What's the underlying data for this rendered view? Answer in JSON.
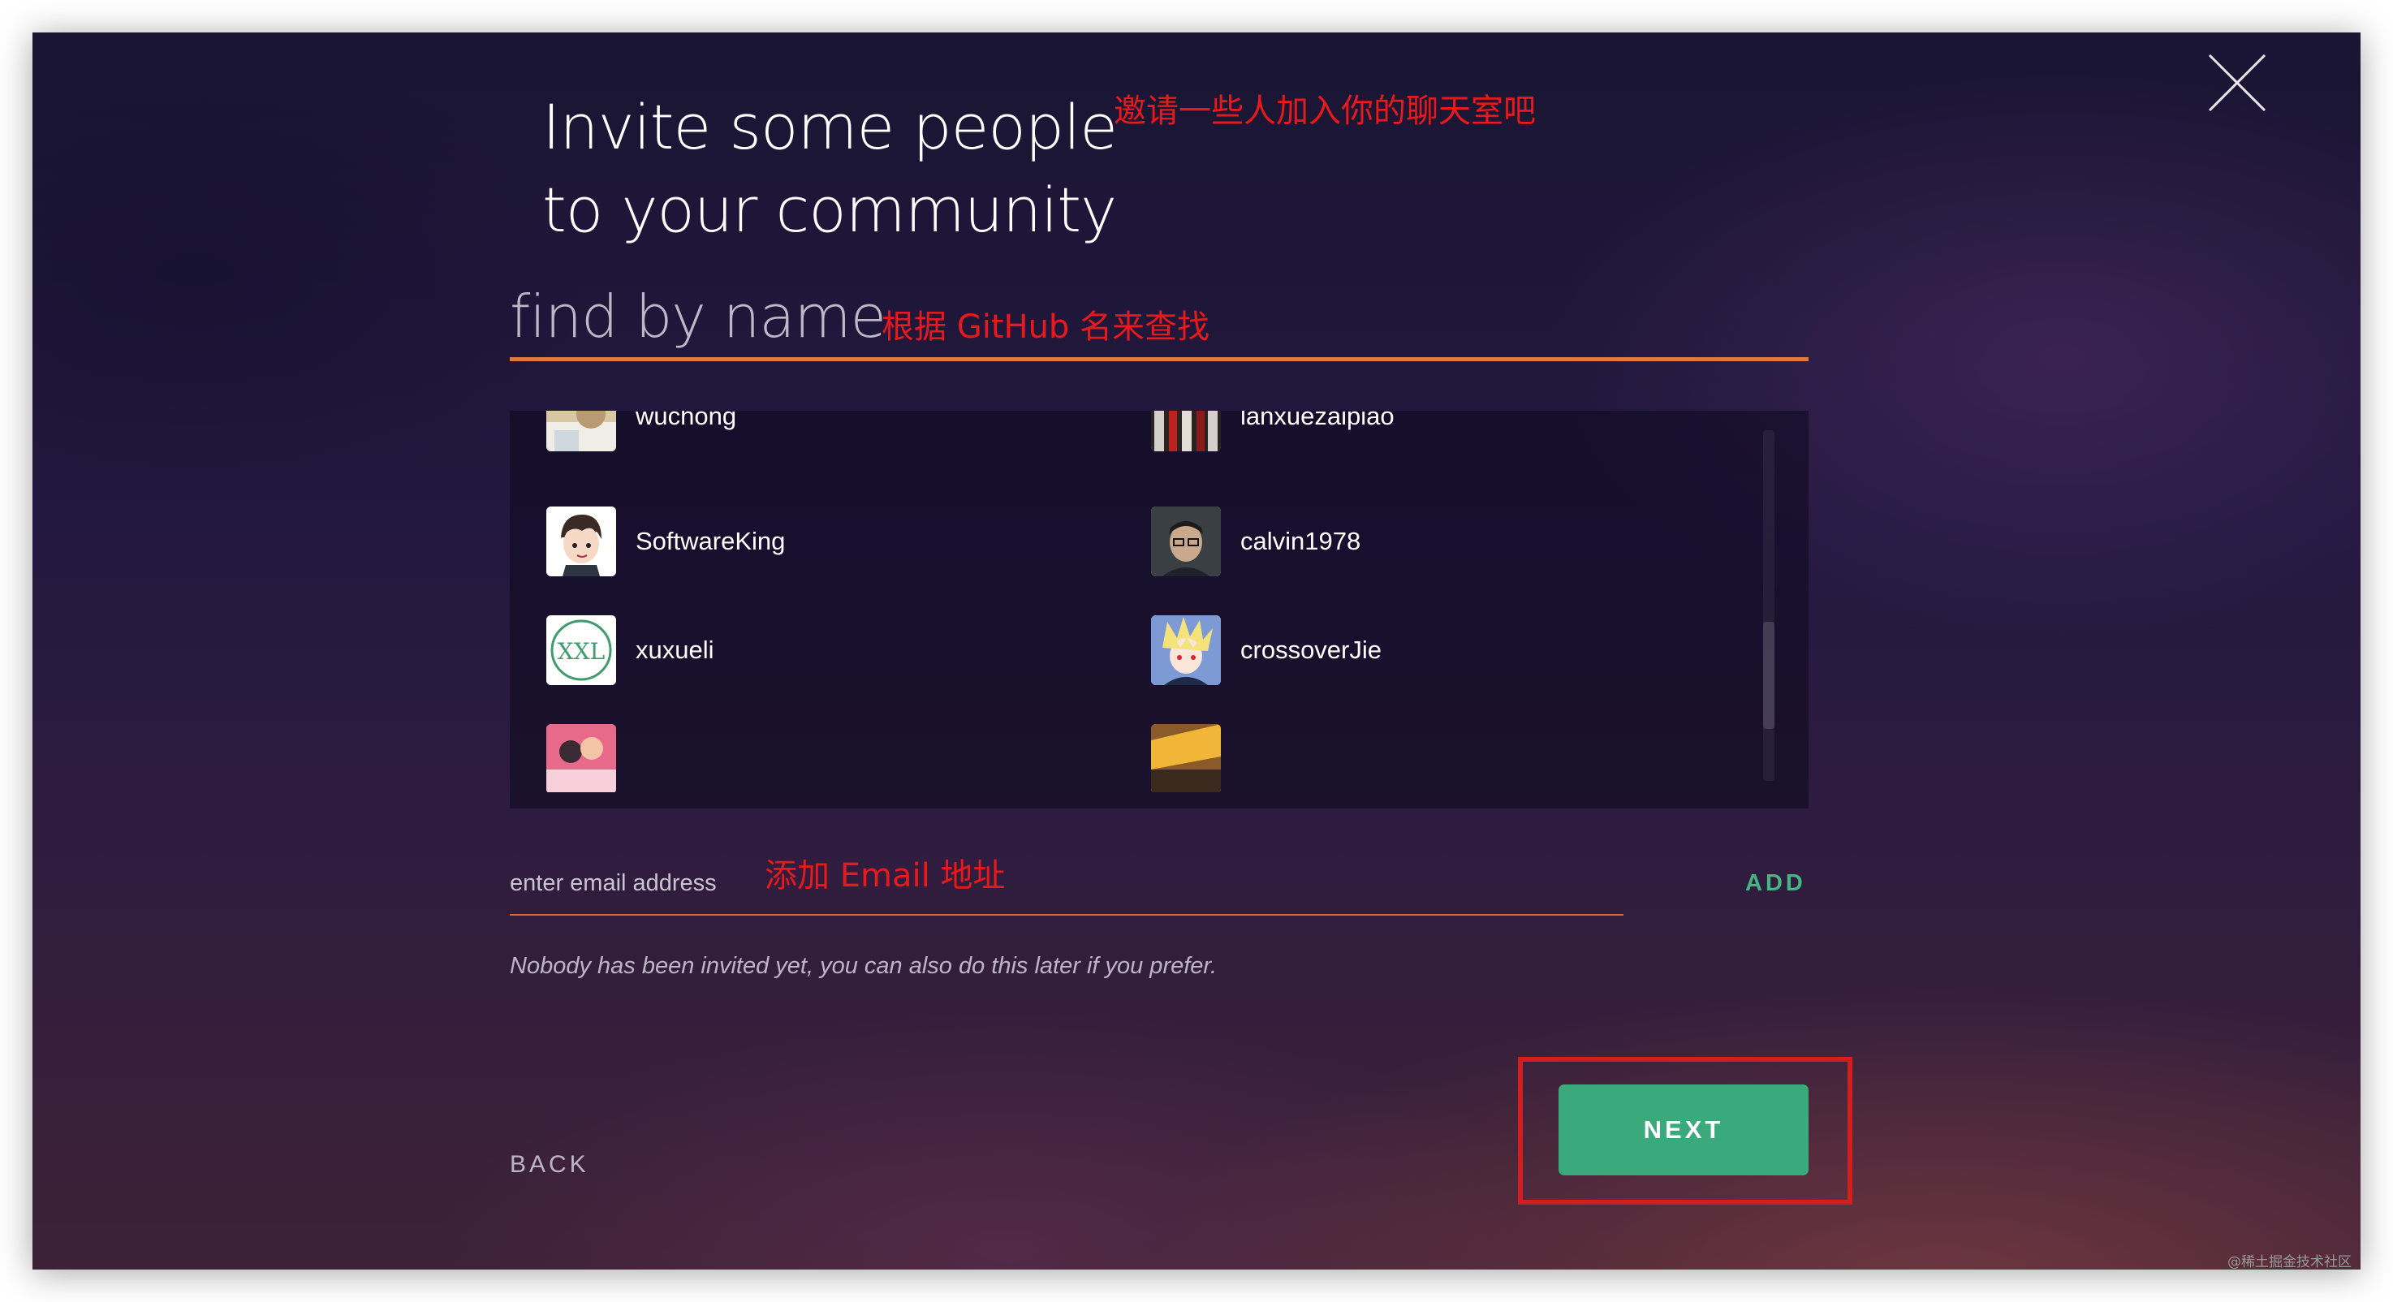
{
  "dialog": {
    "title_line1": "Invite some people",
    "title_line2": "to your community",
    "title_note": "邀请一些人加入你的聊天室吧"
  },
  "search": {
    "placeholder": "find by name",
    "note": "根据 GitHub 名来查找"
  },
  "people": [
    {
      "name": "wuchong",
      "column": "left",
      "avatar": "photo-avatar"
    },
    {
      "name": "lanxuezaipiao",
      "column": "right",
      "avatar": "photo-avatar"
    },
    {
      "name": "SoftwareKing",
      "column": "left",
      "avatar": "cartoon-boy-avatar"
    },
    {
      "name": "calvin1978",
      "column": "right",
      "avatar": "photo-avatar"
    },
    {
      "name": "xuxueli",
      "column": "left",
      "avatar": "xxl-logo-avatar"
    },
    {
      "name": "crossoverJie",
      "column": "right",
      "avatar": "anime-avatar"
    },
    {
      "name": "",
      "column": "left",
      "avatar": "photo-avatar"
    },
    {
      "name": "",
      "column": "right",
      "avatar": "photo-avatar"
    }
  ],
  "email": {
    "placeholder": "enter email address",
    "note": "添加 Email 地址",
    "add_label": "ADD"
  },
  "hint": "Nobody has been invited yet, you can also do this later if you prefer.",
  "footer": {
    "back_label": "BACK",
    "next_label": "NEXT"
  },
  "avatar_logo_text": "XXL",
  "watermark": "@稀土掘金技术社区",
  "colors": {
    "accent_orange": "#e0793a",
    "button_green": "#3aa97b",
    "add_green": "#45b583",
    "annotation_red": "#e8191b"
  }
}
